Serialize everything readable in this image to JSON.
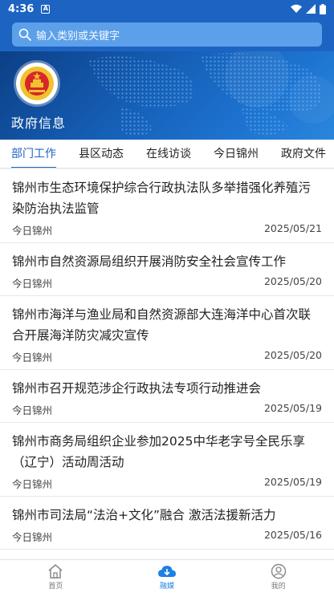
{
  "status": {
    "time": "4:36",
    "notif_glyph": "A"
  },
  "search": {
    "placeholder": "输入类别或关键字"
  },
  "banner": {
    "title": "政府信息"
  },
  "tabs": [
    {
      "label": "部门工作",
      "active": true
    },
    {
      "label": "县区动态",
      "active": false
    },
    {
      "label": "在线访谈",
      "active": false
    },
    {
      "label": "今日锦州",
      "active": false
    },
    {
      "label": "政府文件",
      "active": false
    }
  ],
  "news": [
    {
      "title": "锦州市生态环境保护综合行政执法队多举措强化养殖污染防治执法监管",
      "source": "今日锦州",
      "date": "2025/05/21"
    },
    {
      "title": "锦州市自然资源局组织开展消防安全社会宣传工作",
      "source": "今日锦州",
      "date": "2025/05/20"
    },
    {
      "title": "锦州市海洋与渔业局和自然资源部大连海洋中心首次联合开展海洋防灾减灾宣传",
      "source": "今日锦州",
      "date": "2025/05/20"
    },
    {
      "title": "锦州市召开规范涉企行政执法专项行动推进会",
      "source": "今日锦州",
      "date": "2025/05/19"
    },
    {
      "title": "锦州市商务局组织企业参加2025中华老字号全民乐享（辽宁）活动周活动",
      "source": "今日锦州",
      "date": "2025/05/19"
    },
    {
      "title": "锦州市司法局“法治+文化”融合 激活法援新活力",
      "source": "今日锦州",
      "date": "2025/05/16"
    }
  ],
  "bottom_nav": [
    {
      "label": "首页",
      "icon": "home-icon",
      "active": false
    },
    {
      "label": "融媒",
      "icon": "cloud-icon",
      "active": true
    },
    {
      "label": "我的",
      "icon": "user-icon",
      "active": false
    }
  ],
  "colors": {
    "primary": "#1d64c2",
    "search_bg": "#5da0ea",
    "active_nav": "#1d80e4"
  }
}
